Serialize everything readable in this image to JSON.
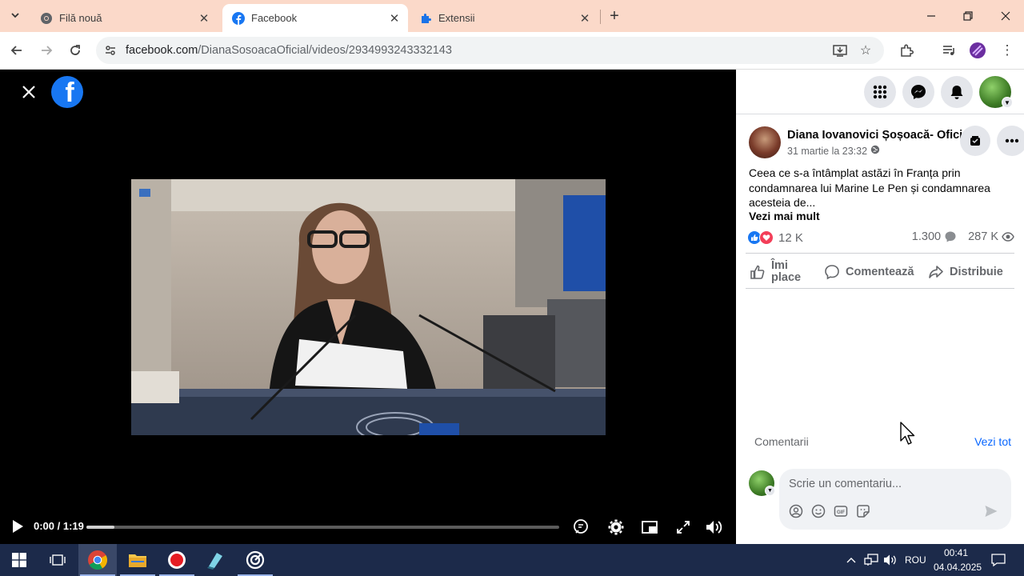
{
  "browser": {
    "tabs": [
      {
        "title": "Filă nouă",
        "favicon": "chrome-icon",
        "active": false
      },
      {
        "title": "Facebook",
        "favicon": "facebook-icon",
        "active": true
      },
      {
        "title": "Extensii",
        "favicon": "puzzle-icon",
        "active": false
      }
    ],
    "url_host": "facebook.com",
    "url_path": "/DianaSosoacaOficial/videos/2934993243332143"
  },
  "video": {
    "timecode": "0:00 / 1:19",
    "buffered_fraction": 0.06,
    "played_fraction": 0.0
  },
  "post": {
    "author": "Diana Iovanovici Șoșoacă- Oficial",
    "date": "31 martie la 23:32",
    "text": "Ceea ce s-a întâmplat astăzi în Franța prin condamnarea lui Marine Le Pen și condamnarea acesteia de...",
    "see_more": "Vezi mai mult",
    "reactions_count": "12 K",
    "comments_count": "1.300",
    "views_count": "287 K",
    "actions": {
      "like": "Îmi place",
      "comment": "Comentează",
      "share": "Distribuie"
    },
    "comments_label": "Comentarii",
    "see_all": "Vezi tot",
    "comment_placeholder": "Scrie un comentariu..."
  },
  "taskbar": {
    "language": "ROU",
    "time": "00:41",
    "date": "04.04.2025"
  },
  "colors": {
    "tab_strip": "#fbd9c9",
    "facebook_blue": "#1877f2",
    "link_blue": "#0866ff",
    "taskbar": "#1c2a4a"
  }
}
